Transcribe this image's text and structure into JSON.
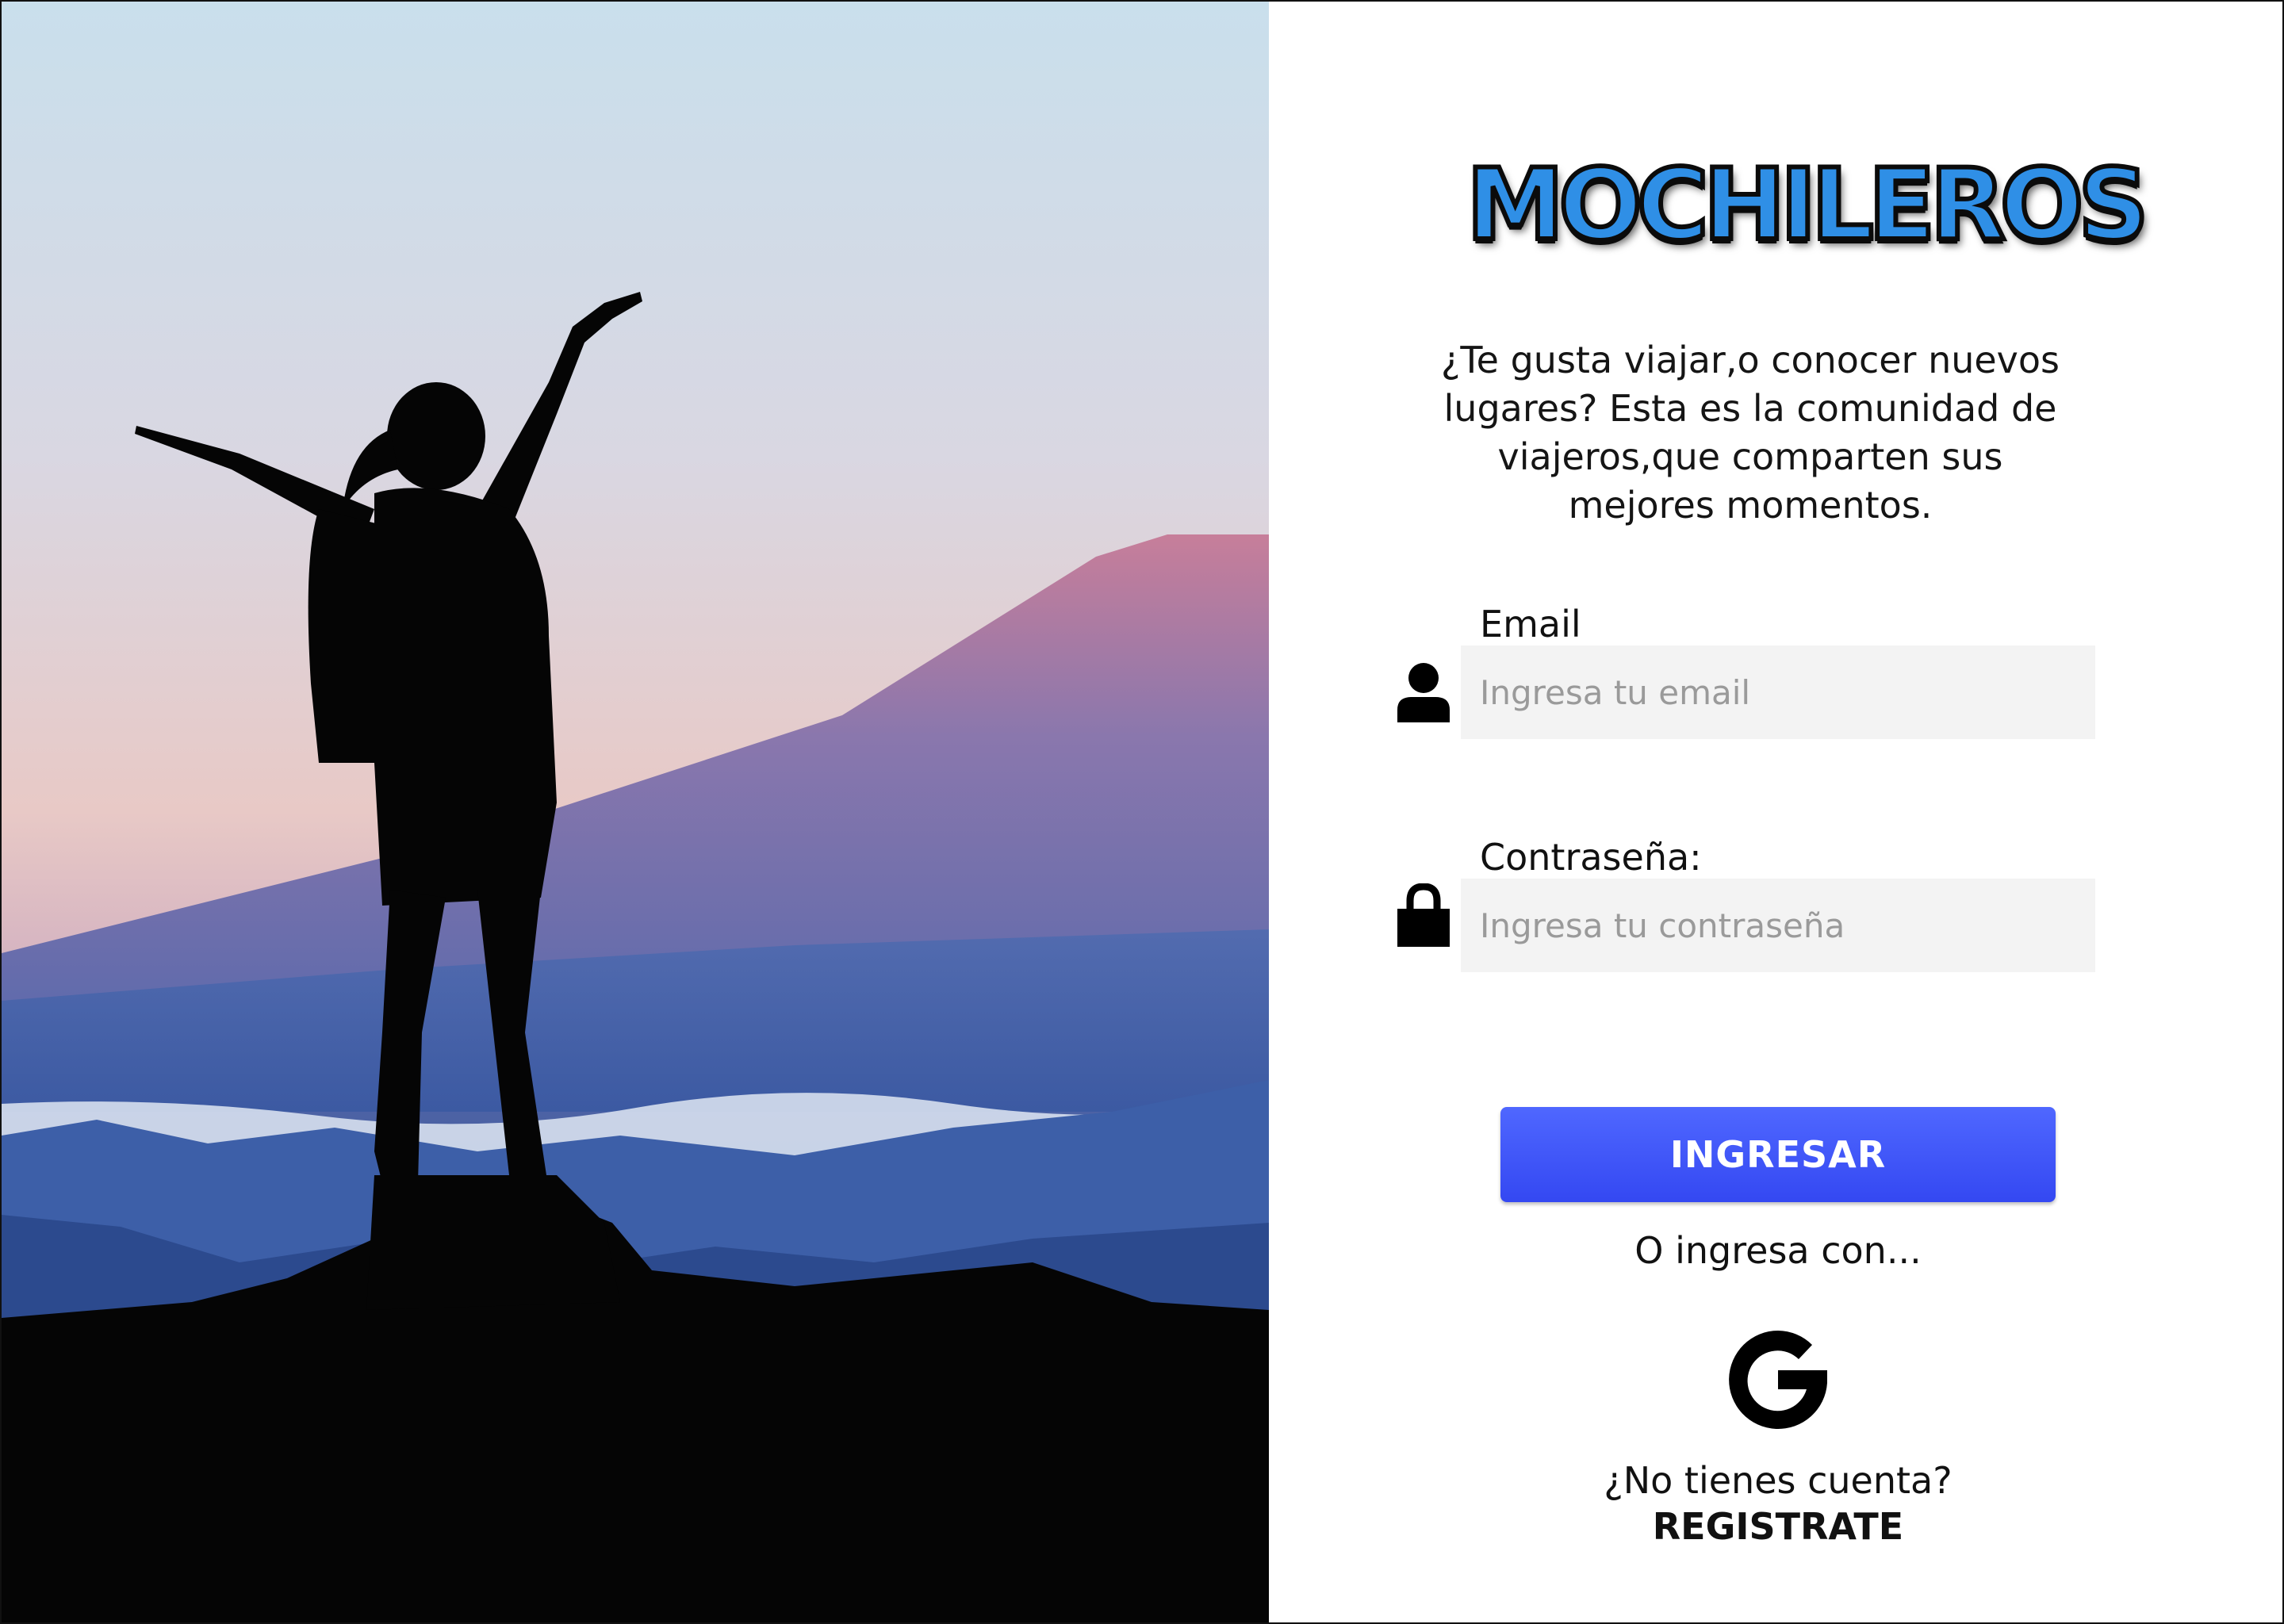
{
  "brand": {
    "logo_text": "MOCHILEROS"
  },
  "tagline": "¿Te gusta viajar,o conocer nuevos lugares? Esta es la comunidad de viajeros,que comparten sus mejores momentos.",
  "email": {
    "label": "Email",
    "placeholder": "Ingresa tu email",
    "icon": "user-icon"
  },
  "password": {
    "label": "Contraseña:",
    "placeholder": "Ingresa tu contraseña",
    "icon": "lock-icon"
  },
  "login_button": "INGRESAR",
  "alt_login_text": "O ingresa con...",
  "social": {
    "icon": "google-icon"
  },
  "signup": {
    "question": "¿No tienes cuenta?",
    "link": "REGISTRATE"
  },
  "colors": {
    "accent": "#3d55f7",
    "logo": "#2f8fe6",
    "input_bg": "#f3f3f3"
  }
}
